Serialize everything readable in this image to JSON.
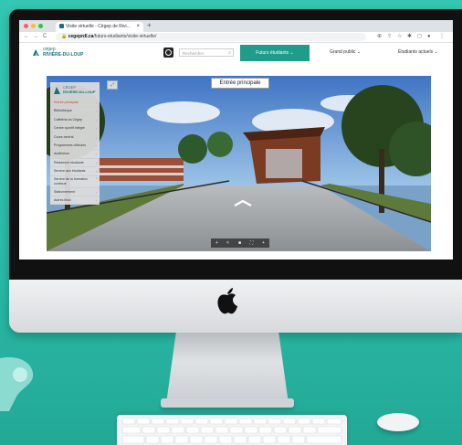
{
  "browser": {
    "tab_title": "Visite virtuelle - Cégep de Rivi...",
    "tab_close": "×",
    "new_tab": "+",
    "url_host": "cegeprdl.ca",
    "url_path": "/futurs-etudiants/visite-virtuelle/",
    "nav": {
      "back": "←",
      "forward": "→",
      "reload": "C"
    },
    "tools": [
      "⊕",
      "⇧",
      "☆",
      "✱",
      "◻",
      "●",
      "⋮"
    ]
  },
  "site": {
    "logo_line1": "cégep",
    "logo_line2": "RIVIÈRE-DU-LOUP",
    "search_placeholder": "Rechercher",
    "search_icon": "search-icon",
    "future_students_label": "Futurs étudiants ⌄",
    "general_public_label": "Grand public ⌄",
    "current_students_label": "Étudiants actuels ⌄"
  },
  "tour": {
    "location_label": "Entrée principale",
    "menu_logo_line1": "CÉGEP",
    "menu_logo_line2": "RIVIÈRE-DU-LOUP",
    "menu_items": [
      "Entrée principale",
      "Bibliothèque",
      "Cafétéria du Cégep",
      "Centre sportif Intégré",
      "Cours central",
      "Programmes d'études",
      "Auditorium",
      "Résidence étudiante",
      "Service aux étudiants",
      "Service de la formation continue",
      "Stationnement",
      "Autres lieux"
    ],
    "active_item": 0,
    "expand_icon": "⤢",
    "controls": [
      "+",
      "<",
      "■",
      "⛶",
      "+"
    ]
  },
  "colors": {
    "accent": "#1f9c8a",
    "brand": "#1a6f86",
    "active_menu": "#d0432e",
    "backdrop": "#2bbba8"
  }
}
